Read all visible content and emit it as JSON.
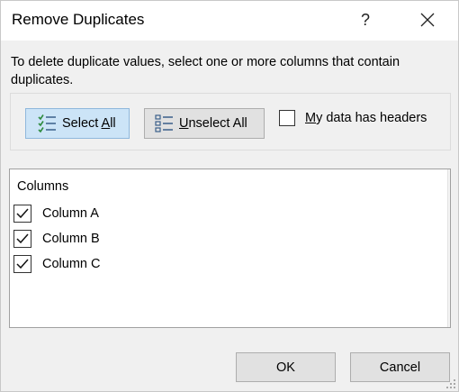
{
  "dialog": {
    "title": "Remove Duplicates",
    "help_glyph": "?",
    "instruction": "To delete duplicate values, select one or more columns that contain duplicates."
  },
  "toolbar": {
    "select_all": {
      "prefix": "Select ",
      "accel": "A",
      "suffix": "ll"
    },
    "unselect_all": {
      "prefix": "",
      "accel": "U",
      "suffix": "nselect All"
    },
    "headers": {
      "prefix": "",
      "accel": "M",
      "suffix": "y data has headers",
      "checked": false
    }
  },
  "columns": {
    "header": "Columns",
    "items": [
      {
        "label": "Column A",
        "checked": true
      },
      {
        "label": "Column B",
        "checked": true
      },
      {
        "label": "Column C",
        "checked": true
      }
    ]
  },
  "footer": {
    "ok_label": "OK",
    "cancel_label": "Cancel"
  },
  "colors": {
    "dialog_bg": "#f0f0f0",
    "title_bar_bg": "#ffffff",
    "select_all_bg": "#cce4f7",
    "select_all_border": "#8fb8dc",
    "button_bg": "#e1e1e1",
    "button_border": "#adadad"
  },
  "icons": [
    "help-icon",
    "close-icon",
    "select-all-icon",
    "unselect-all-icon",
    "checkmark-icon",
    "resize-grip-icon"
  ]
}
